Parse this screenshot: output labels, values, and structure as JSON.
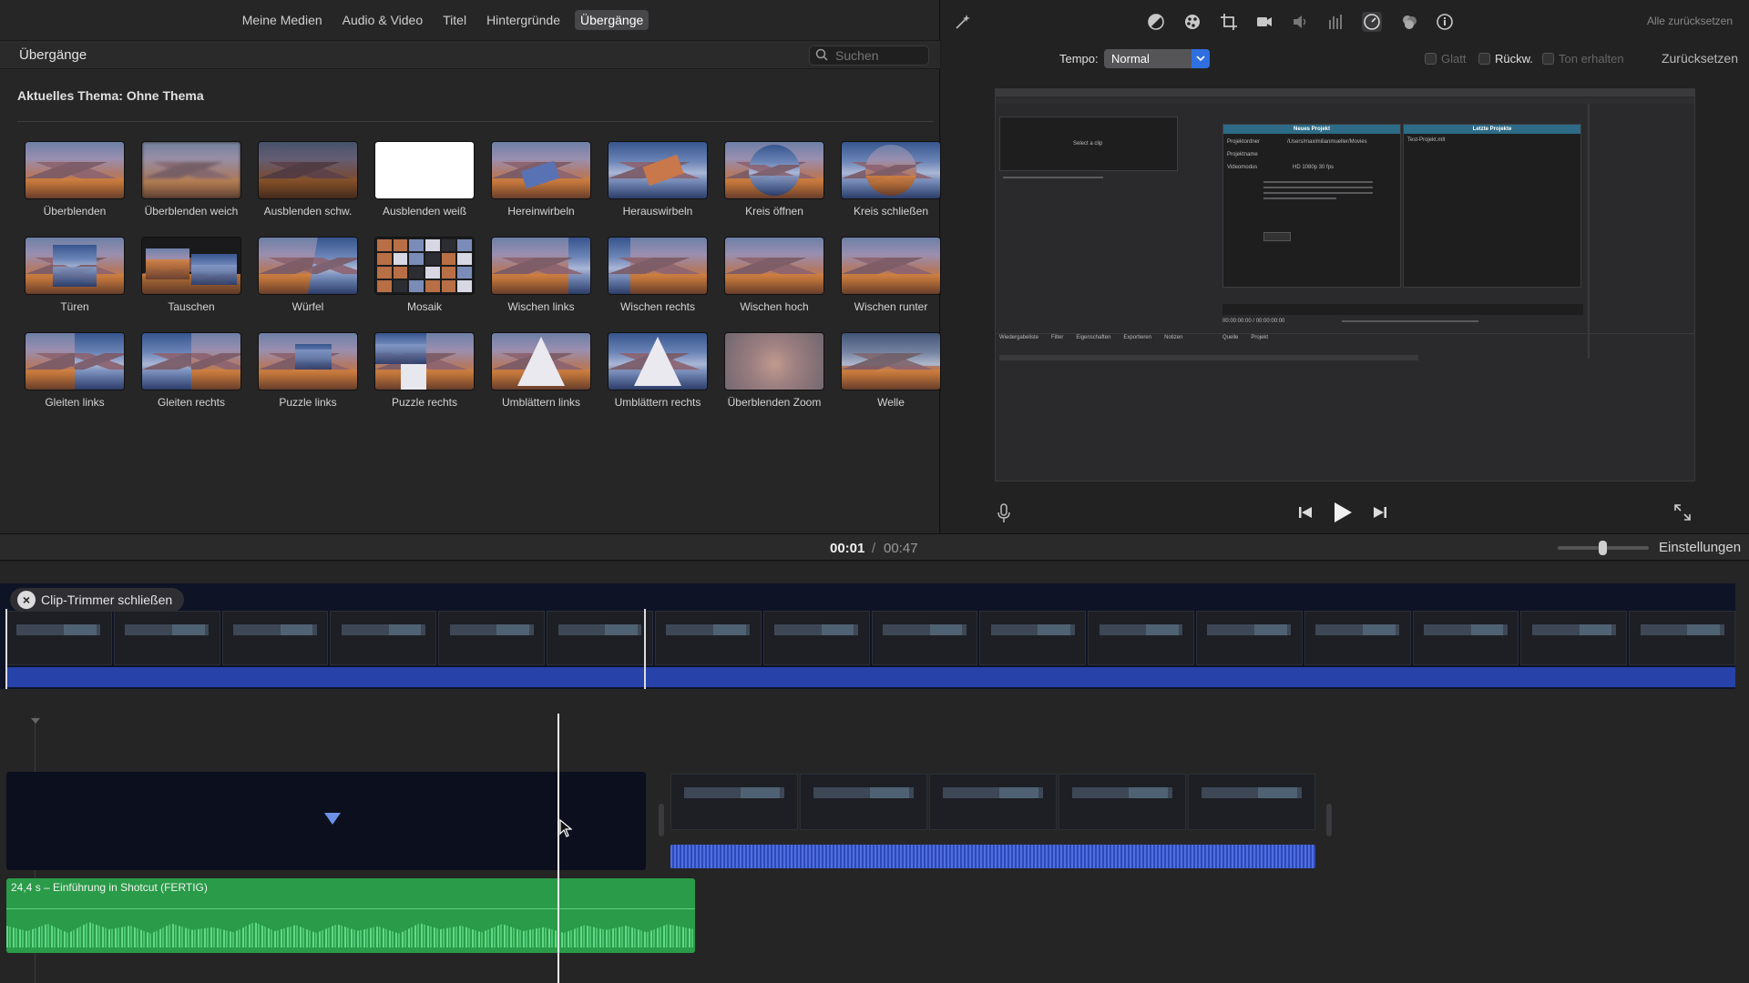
{
  "browser": {
    "nav_tabs": [
      "Meine Medien",
      "Audio & Video",
      "Titel",
      "Hintergründe",
      "Übergänge"
    ],
    "active_tab": "Übergänge",
    "section_title": "Übergänge",
    "search_placeholder": "Suchen",
    "theme_label": "Aktuelles Thema: Ohne Thema",
    "transitions": [
      "Überblenden",
      "Überblenden weich",
      "Ausblenden schw.",
      "Ausblenden weiß",
      "Hereinwirbeln",
      "Herauswirbeln",
      "Kreis öffnen",
      "Kreis schließen",
      "Türen",
      "Tauschen",
      "Würfel",
      "Mosaik",
      "Wischen links",
      "Wischen rechts",
      "Wischen hoch",
      "Wischen runter",
      "Gleiten links",
      "Gleiten rechts",
      "Puzzle links",
      "Puzzle rechts",
      "Umblättern links",
      "Umblättern rechts",
      "Überblenden Zoom",
      "Welle"
    ]
  },
  "inspector": {
    "reset_all": "Alle zurücksetzen",
    "tempo_label": "Tempo:",
    "tempo_value": "Normal",
    "checkboxes": [
      "Glatt",
      "Rückw.",
      "Ton erhalten"
    ],
    "reset": "Zurücksetzen",
    "toolbar_icons": [
      "magic-wand-icon",
      "color-balance-icon",
      "color-correction-icon",
      "crop-icon",
      "stabilization-icon",
      "volume-icon",
      "equalizer-icon",
      "speed-icon",
      "clip-filter-icon",
      "info-icon"
    ]
  },
  "viewer": {
    "select_clip": "Select a clip",
    "new_project": "Neues Projekt",
    "recent_projects": "Letzte Projekte",
    "project_folder_label": "Projektordner",
    "project_folder": "/Users/maximilianmueller/Movies",
    "project_name_label": "Projektname",
    "video_mode_label": "Videomodus",
    "video_mode": "HD 1080p 30 fps",
    "recent_item": "Test-Projekt.mlt",
    "timecode": "00:00:00:00 / 00:00:00:00",
    "bottom_tabs": [
      "Wiedergabeliste",
      "Filter",
      "Eigenschaften",
      "Exportieren",
      "Notizen"
    ],
    "source_tabs": [
      "Quelle",
      "Projekt"
    ]
  },
  "timebar": {
    "current": "00:01",
    "separator": "/",
    "total": "00:47",
    "settings": "Einstellungen"
  },
  "timeline": {
    "close_trimmer": "Clip-Trimmer schließen",
    "audio_clip_label": "24,4 s – Einführung in Shotcut (FERTIG)"
  },
  "colors": {
    "accent_blue": "#2f6fe0",
    "audio_green": "#2a9b48",
    "trim_blue": "#2742a8"
  }
}
